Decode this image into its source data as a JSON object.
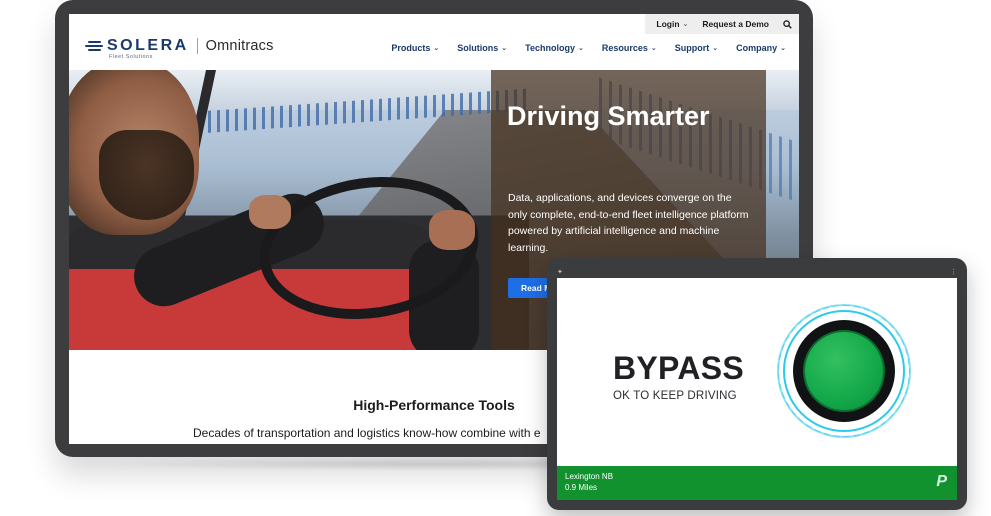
{
  "website": {
    "utility_nav": {
      "login": "Login",
      "request_demo": "Request a Demo"
    },
    "logo": {
      "brand": "SOLERA",
      "brand_sub": "Fleet Solutions",
      "product": "Omnitracs"
    },
    "main_nav": [
      {
        "label": "Products"
      },
      {
        "label": "Solutions"
      },
      {
        "label": "Technology"
      },
      {
        "label": "Resources"
      },
      {
        "label": "Support"
      },
      {
        "label": "Company"
      }
    ],
    "hero": {
      "title": "Driving Smarter",
      "description": "Data, applications, and devices converge on the only complete, end-to-end fleet intelligence platform powered by artificial intelligence and machine learning.",
      "cta_label": "Read M"
    },
    "section": {
      "title": "High-Performance Tools",
      "subtitle": "Decades of transportation and logistics know-how combine with e"
    }
  },
  "tablet_app": {
    "status_title": "BYPASS",
    "status_subtitle": "OK TO KEEP DRIVING",
    "status_color": "#13a84a",
    "footer": {
      "location": "Lexington NB",
      "distance": "0.9 Miles",
      "logo": "P",
      "color": "#12922f"
    }
  },
  "icons": [
    "search-icon",
    "chevron-down-icon",
    "solera-logo-icon",
    "status-light-icon"
  ]
}
